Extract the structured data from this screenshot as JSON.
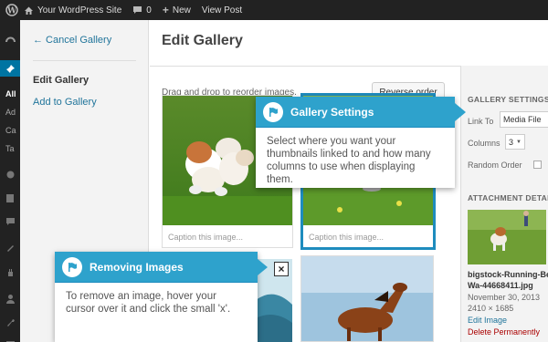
{
  "admin_bar": {
    "site_name": "Your WordPress Site",
    "comments_count": "0",
    "new_label": "New",
    "view_post_label": "View Post"
  },
  "admin_menu": {
    "submenu": [
      "All",
      "Ad",
      "Ca",
      "Ta"
    ],
    "current_submenu_index": 0
  },
  "media_menu": {
    "back_link": "← Cancel Gallery",
    "items": [
      "Edit Gallery",
      "Add to Gallery"
    ]
  },
  "frame": {
    "title": "Edit Gallery",
    "instructions": "Drag and drop to reorder images.",
    "reverse_label": "Reverse order"
  },
  "gallery": {
    "caption_placeholder": "Caption this image..."
  },
  "gallery_settings": {
    "heading": "GALLERY SETTINGS",
    "link_to_label": "Link To",
    "link_to_value": "Media File",
    "columns_label": "Columns",
    "columns_value": "3",
    "random_order_label": "Random Order"
  },
  "attachment": {
    "heading": "ATTACHMENT DETAILS",
    "filename_line1": "bigstock-Running-Bea",
    "filename_line2": "Wa-44668411.jpg",
    "date": "November 30, 2013",
    "dimensions": "2410 × 1685",
    "edit_link": "Edit Image",
    "delete_link": "Delete Permanently"
  },
  "pointer_settings": {
    "title": "Gallery Settings",
    "body": "Select where you want  your thumbnails linked to and how many columns to use when displaying them."
  },
  "pointer_remove": {
    "title": "Removing Images",
    "body": "To remove an image, hover your cursor over it and click the small 'x'."
  },
  "colors": {
    "pointer_header": "#2ea2cc",
    "admin_bar": "#222222",
    "link": "#21759b",
    "delete": "#aa0000",
    "selected_border": "#1e8cbe"
  }
}
